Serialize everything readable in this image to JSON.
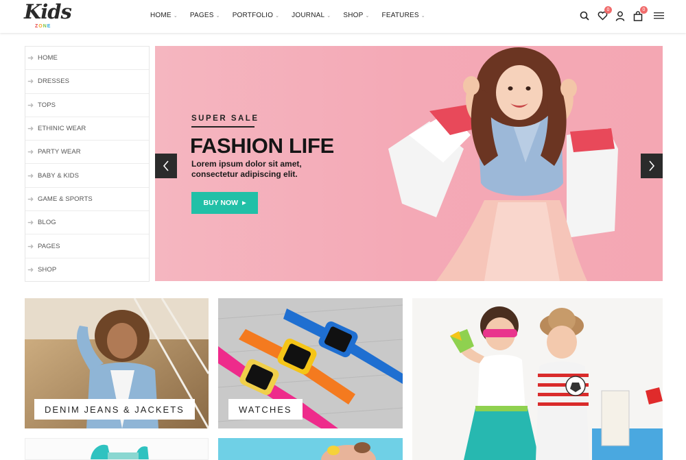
{
  "brand": {
    "logo_main": "Kids",
    "logo_sub": [
      "Z",
      "O",
      "N",
      "E"
    ]
  },
  "nav": {
    "items": [
      {
        "label": "HOME"
      },
      {
        "label": "PAGES"
      },
      {
        "label": "PORTFOLIO"
      },
      {
        "label": "JOURNAL"
      },
      {
        "label": "SHOP"
      },
      {
        "label": "FEATURES"
      }
    ]
  },
  "header_icons": {
    "search": "search-icon",
    "wishlist": {
      "icon": "heart-icon",
      "count": "0"
    },
    "account": "user-icon",
    "cart": {
      "icon": "shopping-bag-icon",
      "count": "0"
    },
    "menu": "hamburger-menu-icon"
  },
  "sidebar": {
    "items": [
      {
        "label": "HOME"
      },
      {
        "label": "DRESSES"
      },
      {
        "label": "TOPS"
      },
      {
        "label": "ETHINIC WEAR"
      },
      {
        "label": "PARTY WEAR"
      },
      {
        "label": "BABY & KIDS"
      },
      {
        "label": "GAME & SPORTS"
      },
      {
        "label": "BLOG"
      },
      {
        "label": "PAGES"
      },
      {
        "label": "SHOP"
      }
    ]
  },
  "hero": {
    "kicker": "SUPER SALE",
    "title": "FASHION LIFE",
    "text": "Lorem ipsum dolor sit amet, consectetur adipiscing elit.",
    "button_label": "BUY NOW",
    "button_color": "#21c0a7",
    "background_color": "#f4a9b6"
  },
  "tiles": {
    "denim": {
      "label": "DENIM JEANS & JACKETS"
    },
    "watches": {
      "label": "WATCHES"
    }
  },
  "colors": {
    "accent": "#21c0a7",
    "badge": "#f06b6b",
    "dark": "#2b2b2b"
  }
}
